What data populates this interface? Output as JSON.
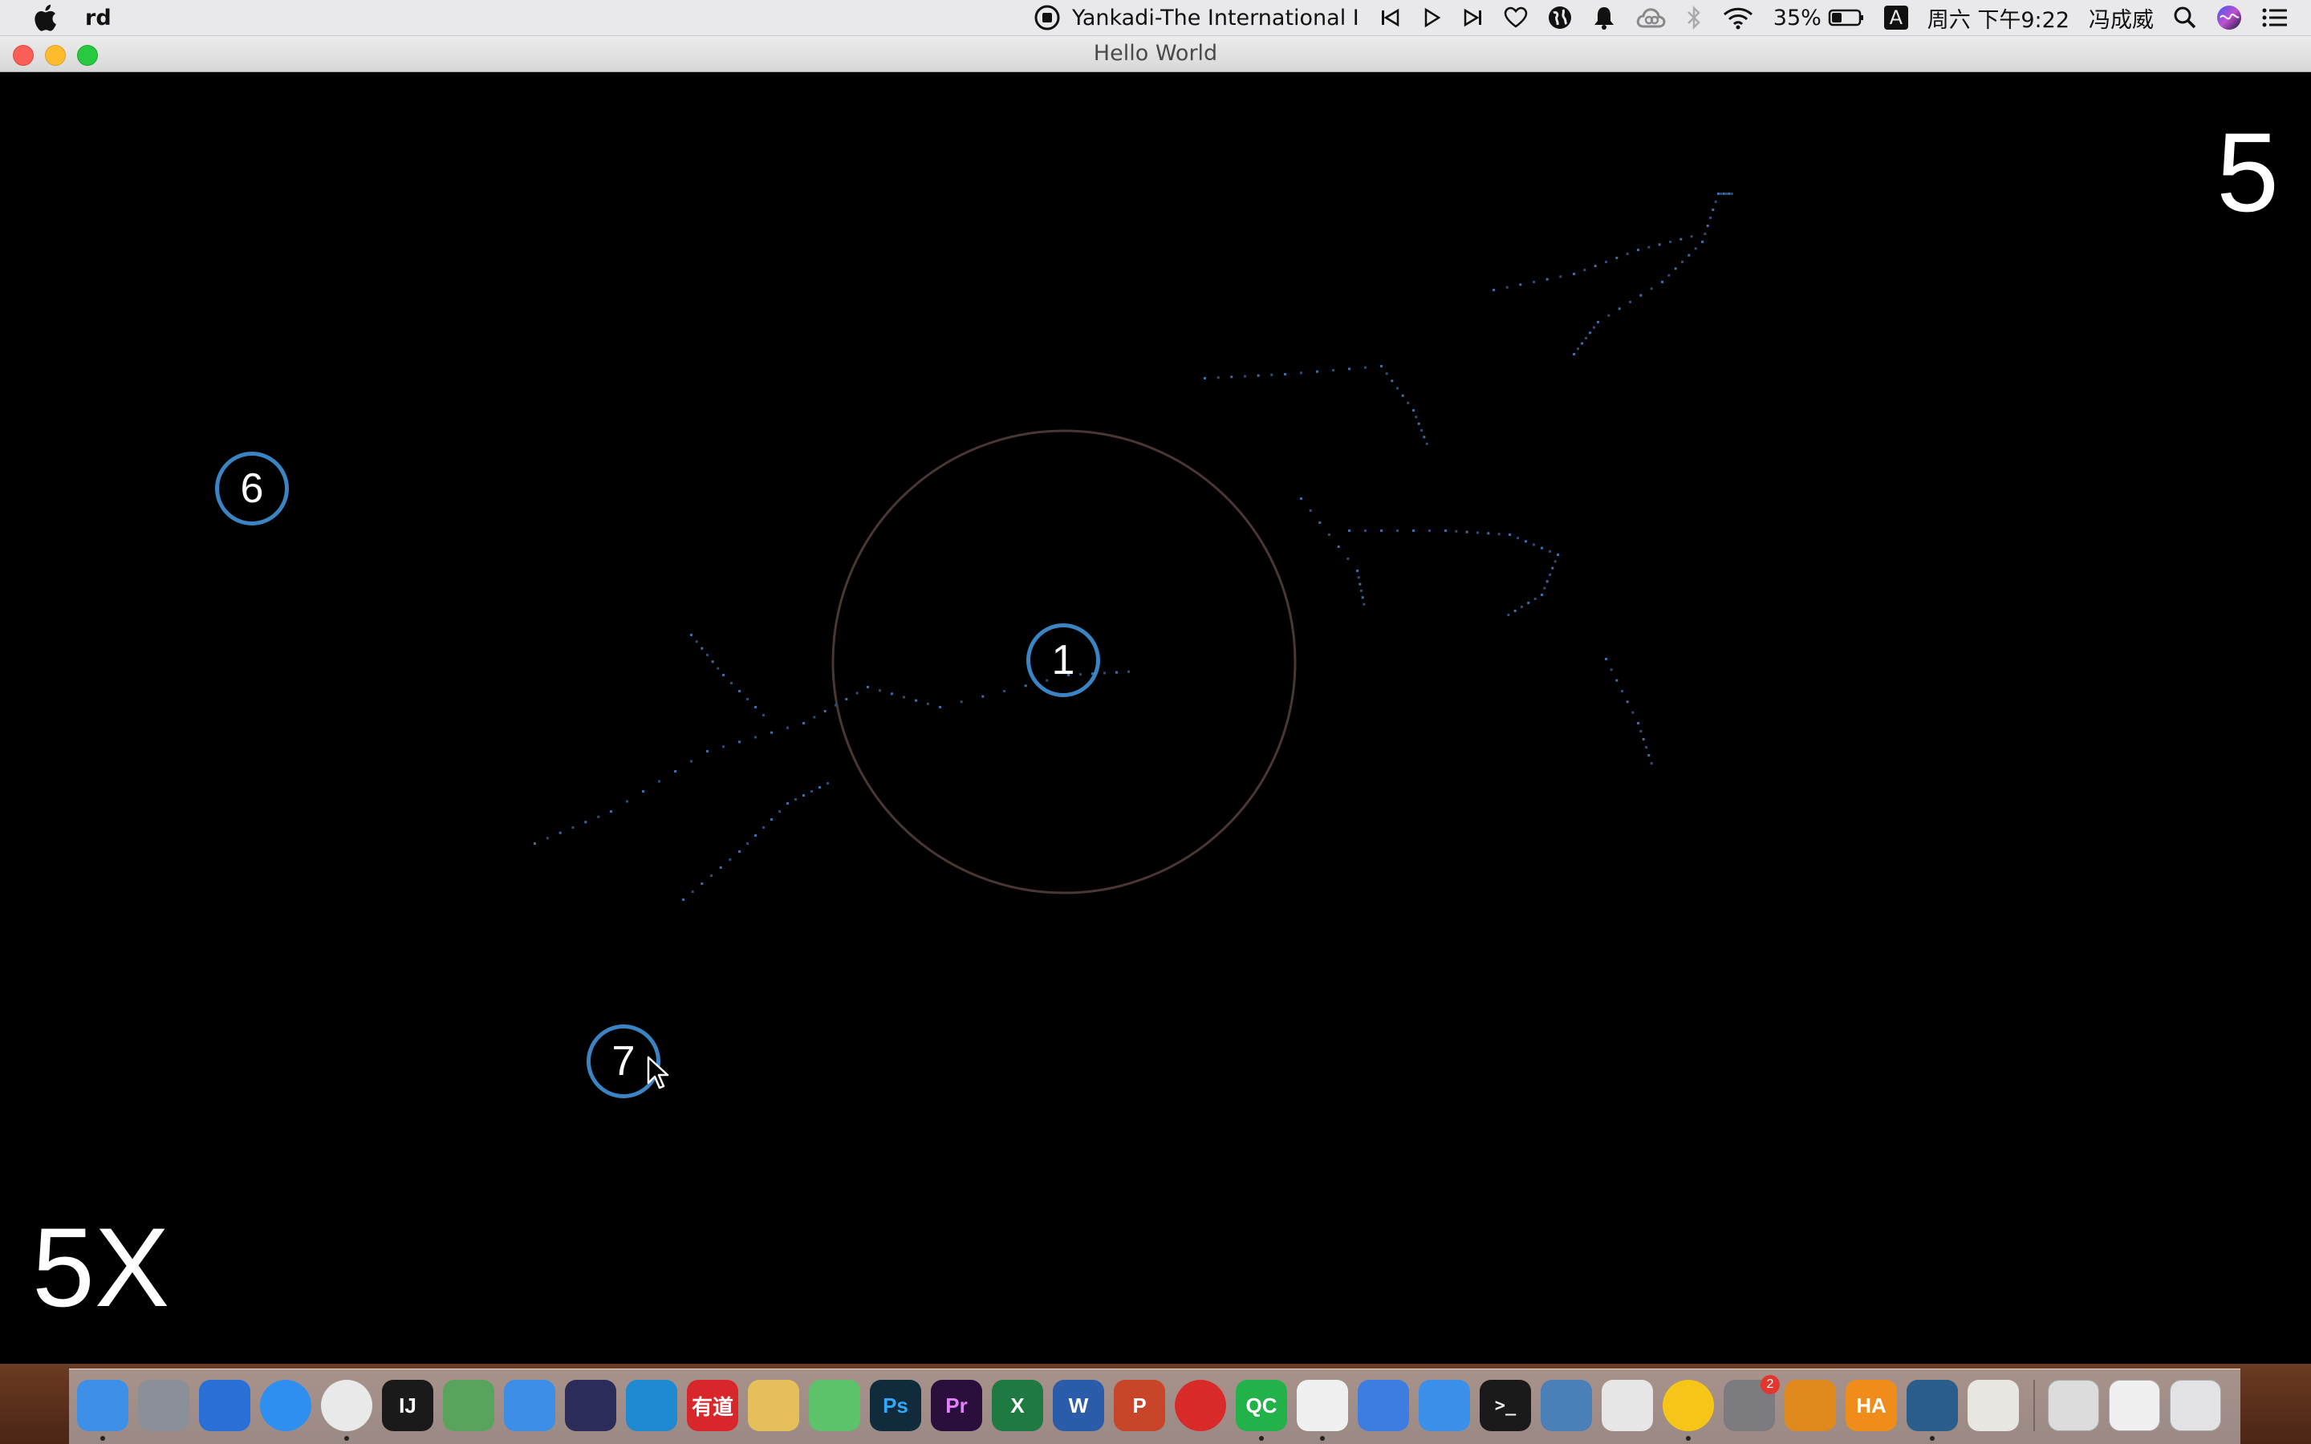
{
  "menubar": {
    "app_name": "rd",
    "now_playing": "Yankadi-The International I",
    "battery_percent": "35%",
    "input_method": "A",
    "datetime": "周六 下午9:22",
    "user": "冯成威"
  },
  "window": {
    "title": "Hello World"
  },
  "game": {
    "level_number": "5",
    "multiplier": "5X",
    "targets": [
      {
        "label": "1"
      },
      {
        "label": "6"
      },
      {
        "label": "7"
      }
    ]
  },
  "dock": {
    "apps": [
      {
        "name": "finder-icon",
        "label": "",
        "color": "#3d8fe8",
        "running": true
      },
      {
        "name": "launchpad-icon",
        "label": "",
        "color": "#8a8f98",
        "running": false
      },
      {
        "name": "dashboard-icon",
        "label": "",
        "color": "#2a6fd6",
        "running": false
      },
      {
        "name": "safari-icon",
        "label": "",
        "color": "#2f8ff0",
        "running": false
      },
      {
        "name": "chrome-icon",
        "label": "",
        "color": "#e9e9e9",
        "running": true
      },
      {
        "name": "intellij-icon",
        "label": "IJ",
        "color": "#1a1a1a",
        "running": false
      },
      {
        "name": "android-studio-icon",
        "label": "",
        "color": "#5aa35c",
        "running": false
      },
      {
        "name": "xcode-icon",
        "label": "",
        "color": "#3d8ee6",
        "running": false
      },
      {
        "name": "eclipse-icon",
        "label": "",
        "color": "#2c2c5a",
        "running": false
      },
      {
        "name": "vscode-icon",
        "label": "",
        "color": "#1f8ad2",
        "running": false
      },
      {
        "name": "youdao-icon",
        "label": "有道",
        "color": "#d8262b",
        "running": false
      },
      {
        "name": "bean-icon",
        "label": "",
        "color": "#e5c05a",
        "running": false
      },
      {
        "name": "iqiyi-icon",
        "label": "",
        "color": "#5cc36a",
        "running": false
      },
      {
        "name": "photoshop-icon",
        "label": "Ps",
        "color": "#0f2b3c",
        "running": false
      },
      {
        "name": "premiere-icon",
        "label": "Pr",
        "color": "#2a0f3c",
        "running": false
      },
      {
        "name": "excel-icon",
        "label": "X",
        "color": "#1f7a42",
        "running": false
      },
      {
        "name": "word-icon",
        "label": "W",
        "color": "#2b5caa",
        "running": false
      },
      {
        "name": "powerpoint-icon",
        "label": "P",
        "color": "#c9452a",
        "running": false
      },
      {
        "name": "netease-music-icon",
        "label": "",
        "color": "#d92a2a",
        "running": false
      },
      {
        "name": "qc-icon",
        "label": "QC",
        "color": "#23b24a",
        "running": true
      },
      {
        "name": "qq-icon",
        "label": "",
        "color": "#f0f0f0",
        "running": true
      },
      {
        "name": "baidu-netdisk-icon",
        "label": "",
        "color": "#3d7de0",
        "running": false
      },
      {
        "name": "feishu-icon",
        "label": "",
        "color": "#3a90e8",
        "running": false
      },
      {
        "name": "terminal-icon",
        "label": ">_",
        "color": "#1a1a1a",
        "running": false
      },
      {
        "name": "vmware-icon",
        "label": "",
        "color": "#4a7fb8",
        "running": false
      },
      {
        "name": "wechat-icon",
        "label": "",
        "color": "#e6e6e6",
        "running": false
      },
      {
        "name": "qq-music-icon",
        "label": "",
        "color": "#f5c518",
        "running": true
      },
      {
        "name": "system-preferences-icon",
        "label": "",
        "color": "#7c7c80",
        "running": false
      },
      {
        "name": "game-icon",
        "label": "",
        "color": "#e08a1e",
        "running": false
      },
      {
        "name": "ha-icon",
        "label": "HA",
        "color": "#f08c1a",
        "running": false
      },
      {
        "name": "quicktime-icon",
        "label": "",
        "color": "#2a5c8c",
        "running": true
      },
      {
        "name": "preview-icon",
        "label": "",
        "color": "#e8e6e0",
        "running": false
      }
    ],
    "right_items": [
      {
        "name": "document-stack-icon",
        "color": "#dcdcdc"
      },
      {
        "name": "downloads-stack-icon",
        "color": "#f0f0f0"
      },
      {
        "name": "trash-icon",
        "color": "#e3e3e6"
      }
    ],
    "system_preferences_badge": "2"
  }
}
